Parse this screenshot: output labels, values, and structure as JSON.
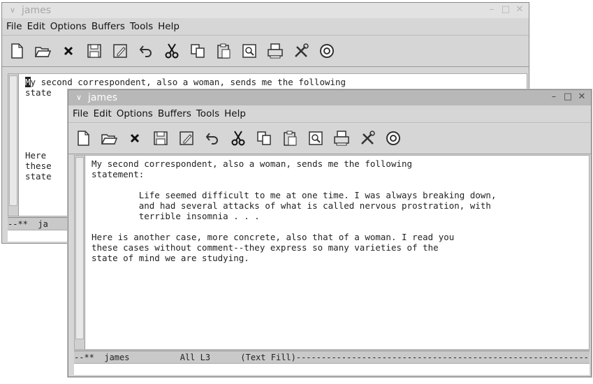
{
  "back_window": {
    "title": "james",
    "menu": [
      "File",
      "Edit",
      "Options",
      "Buffers",
      "Tools",
      "Help"
    ],
    "lines": [
      "My second correspondent, also a woman, sends me the following",
      "state",
      "",
      "",
      "",
      "",
      "",
      "Here",
      "these",
      "state"
    ],
    "cursor_char": "M",
    "first_line_rest": "y second correspondent, also a woman, sends me the following",
    "modeline": "--**  ja"
  },
  "front_window": {
    "title": "james",
    "menu": [
      "File",
      "Edit",
      "Options",
      "Buffers",
      "Tools",
      "Help"
    ],
    "text": "My second correspondent, also a woman, sends me the following\nstatement:\n\n         Life seemed difficult to me at one time. I was always breaking down,\n         and had several attacks of what is called nervous prostration, with\n         terrible insomnia . . .\n\nHere is another case, more concrete, also that of a woman. I read you\nthese cases without comment--they express so many varieties of the\nstate of mind we are studying.",
    "modeline": "--**  james          All L3      (Text Fill)-----------------------------------------------------------"
  },
  "toolbar_icons": [
    "new-file-icon",
    "open-folder-icon",
    "close-x-icon",
    "save-disk-icon",
    "save-as-icon",
    "undo-icon",
    "cut-scissors-icon",
    "copy-icon",
    "paste-icon",
    "search-icon",
    "print-icon",
    "preferences-tools-icon",
    "help-lifebuoy-icon"
  ]
}
